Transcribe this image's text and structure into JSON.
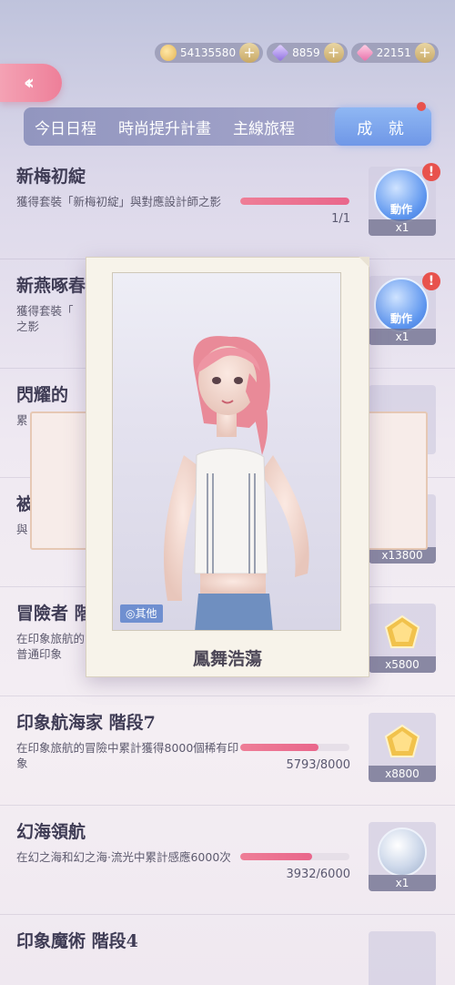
{
  "currency": {
    "coins": "54135580",
    "diamonds": "8859",
    "gems": "22151"
  },
  "tabs": [
    {
      "label": "今日日程"
    },
    {
      "label": "時尚提升計畫"
    },
    {
      "label": "主線旅程"
    },
    {
      "label": "成 就"
    }
  ],
  "achievements": [
    {
      "title": "新梅初綻",
      "desc": "獲得套裝「新梅初綻」與對應設計師之影",
      "progress": "1/1",
      "fill": 1.0,
      "reward_label": "動作",
      "reward_count": "x1",
      "alert": "!"
    },
    {
      "title": "新燕啄春",
      "desc": "獲得套裝「",
      "desc2": "之影",
      "progress": "",
      "fill": 1.0,
      "reward_label": "動作",
      "reward_count": "x1",
      "alert": "!"
    },
    {
      "title": "閃耀的",
      "desc": "累",
      "progress": "",
      "fill": 0.0,
      "reward_label": "",
      "reward_count": ""
    },
    {
      "title": "被",
      "desc": "與",
      "progress": "",
      "fill": 0.0,
      "reward_label": "",
      "reward_count": "x13800"
    },
    {
      "title": "冒險者 階",
      "desc": "在印象旅航的",
      "desc2": "普通印象",
      "progress": "",
      "fill": 0.0,
      "reward_label": "",
      "reward_count": "x5800"
    },
    {
      "title": "印象航海家 階段7",
      "desc": "在印象旅航的冒險中累計獲得8000個稀有印象",
      "progress": "5793/8000",
      "fill": 0.72,
      "reward_label": "",
      "reward_count": "x8800"
    },
    {
      "title": "幻海領航",
      "desc": "在幻之海和幻之海·流光中累計感應6000次",
      "progress": "3932/6000",
      "fill": 0.66,
      "reward_label": "",
      "reward_count": "x1"
    },
    {
      "title": "印象魔術 階段4",
      "desc": "",
      "progress": "",
      "fill": 0.0,
      "reward_label": "",
      "reward_count": ""
    }
  ],
  "popup": {
    "caption": "鳳舞浩蕩",
    "tag": "其他"
  },
  "colors": {
    "accent_pink": "#ee7f99",
    "tab_active": "#6f97e7",
    "alert_red": "#e8524d"
  }
}
